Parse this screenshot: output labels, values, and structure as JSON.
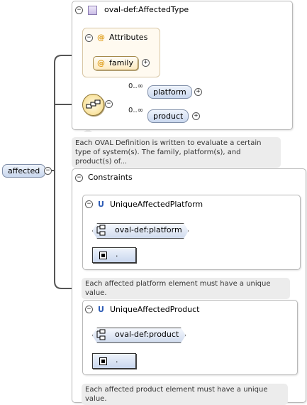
{
  "root_element": {
    "label": "affected"
  },
  "type": {
    "name": "oval-def:AffectedType",
    "attributes_header": "Attributes",
    "attribute": "family",
    "sequence": {
      "items": [
        {
          "label": "platform",
          "multiplicity": "0..∞"
        },
        {
          "label": "product",
          "multiplicity": "0..∞"
        }
      ]
    }
  },
  "documentation": "Each OVAL Definition is written to evaluate a certain type of system(s). The family, platform(s), and product(s) of...",
  "constraints": {
    "header": "Constraints",
    "items": [
      {
        "kind": "U",
        "name": "UniqueAffectedPlatform",
        "selector": "oval-def:platform",
        "field": ".",
        "documentation": "Each affected platform element must have a unique value."
      },
      {
        "kind": "U",
        "name": "UniqueAffectedProduct",
        "selector": "oval-def:product",
        "field": ".",
        "documentation": "Each affected product element must have a unique value."
      }
    ]
  },
  "icons": {
    "collapse": "minus-circle-icon",
    "expand": "plus-circle-icon",
    "type": "complex-type-icon",
    "sequence": "sequence-compositor-icon",
    "selector": "selector-icon",
    "field": "field-icon"
  },
  "colors": {
    "element_fill": "#c9d7ee",
    "attribute_fill": "#fdebc0",
    "unique_letter": "#2c5bb5",
    "attribute_marker": "#e0a020"
  }
}
